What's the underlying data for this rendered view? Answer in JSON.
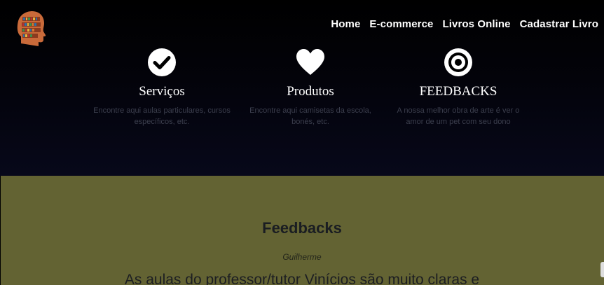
{
  "header": {
    "logo_icon": "head-bookshelf-icon",
    "nav": [
      {
        "label": "Home"
      },
      {
        "label": "E-commerce"
      },
      {
        "label": "Livros Online"
      },
      {
        "label": "Cadastrar Livro"
      }
    ]
  },
  "features": [
    {
      "icon": "check-circle-icon",
      "title": "Serviços",
      "desc": "Encontre aqui aulas particulares, cursos específicos, etc."
    },
    {
      "icon": "heart-icon",
      "title": "Produtos",
      "desc": "Encontre aqui camisetas da escola, bonés, etc."
    },
    {
      "icon": "target-icon",
      "title": "FEEDBACKS",
      "desc": "A nossa melhor obra de arte é ver o amor de um pet com seu dono"
    }
  ],
  "feedbacks": {
    "heading": "Feedbacks",
    "author": "Guilherme",
    "quote": "As aulas do professor/tutor Vinícios são muito claras e"
  },
  "colors": {
    "hero_background": "#000000",
    "section_background": "#636333",
    "nav_text": "#ffffff",
    "feature_desc": "#3c3f4e"
  }
}
